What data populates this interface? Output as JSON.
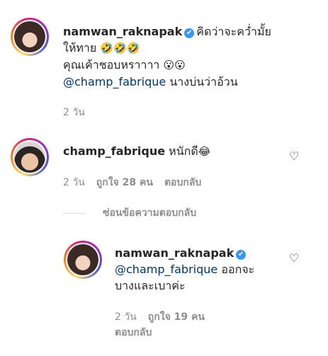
{
  "comments": [
    {
      "username": "namwan_raknapak",
      "verified_icon": "✔",
      "line1": "คิดว่าจะคว่ำมั้ย",
      "line2": "ให้ทาย",
      "line2_emojis": "🤣🤣🤣",
      "line3": "คุณเค้าชอบหราาาา",
      "line3_emojis": "😮😮",
      "mention": "@champ_fabrique",
      "mention_text": "นางบ่นว่าอ้วน",
      "time": "2 วัน"
    },
    {
      "username": "champ_fabrique",
      "text": "หนักดี",
      "emoji": "😂",
      "time": "2 วัน",
      "likes": "ถูกใจ 28 คน",
      "reply_label": "ตอบกลับ"
    }
  ],
  "hide_replies_label": "ซ่อนข้อความตอบกลับ",
  "reply": {
    "username": "namwan_raknapak",
    "verified_icon": "✔",
    "mention": "@champ_fabrique",
    "text1": "ออกจะ",
    "text2": "บางและเบาค่ะ",
    "time": "2 วัน",
    "likes": "ถูกใจ 19 คน",
    "reply_label": "ตอบกลับ"
  },
  "icons": {
    "heart": "♡"
  }
}
